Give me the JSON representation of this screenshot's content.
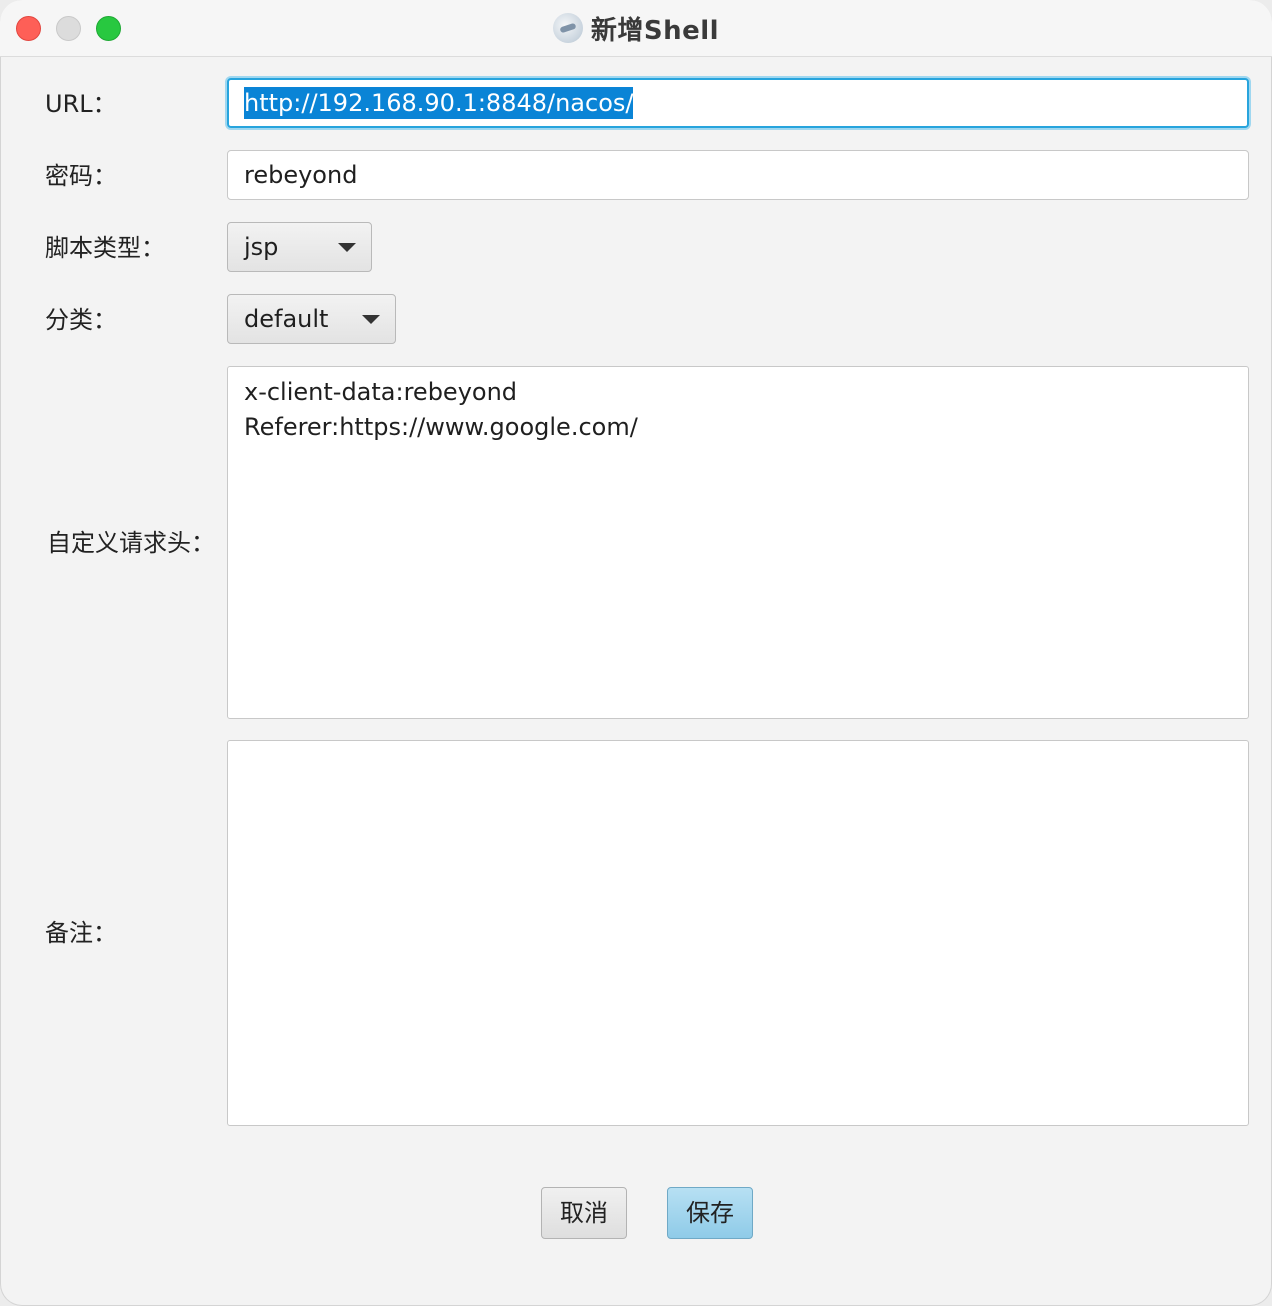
{
  "window": {
    "title": "新增Shell",
    "app_icon": "shell-app-icon"
  },
  "form": {
    "url": {
      "label": "URL：",
      "value": "http://192.168.90.1:8848/nacos/"
    },
    "password": {
      "label": "密码：",
      "value": "rebeyond"
    },
    "script_type": {
      "label": "脚本类型：",
      "selected": "jsp"
    },
    "category": {
      "label": "分类：",
      "selected": "default"
    },
    "custom_headers": {
      "label": "自定义请求头：",
      "lines": [
        "x-client-data:rebeyond",
        "Referer:https://www.google.com/"
      ]
    },
    "remarks": {
      "label": "备注：",
      "value": ""
    }
  },
  "buttons": {
    "cancel_label": "取消",
    "save_label": "保存"
  },
  "colors": {
    "focus_ring": "#27a4dd",
    "selection": "#0a84d6",
    "save_button": "#8fcbe8",
    "traffic_close": "#fe5f57",
    "traffic_min": "#dcdcdc",
    "traffic_max": "#28c840"
  }
}
